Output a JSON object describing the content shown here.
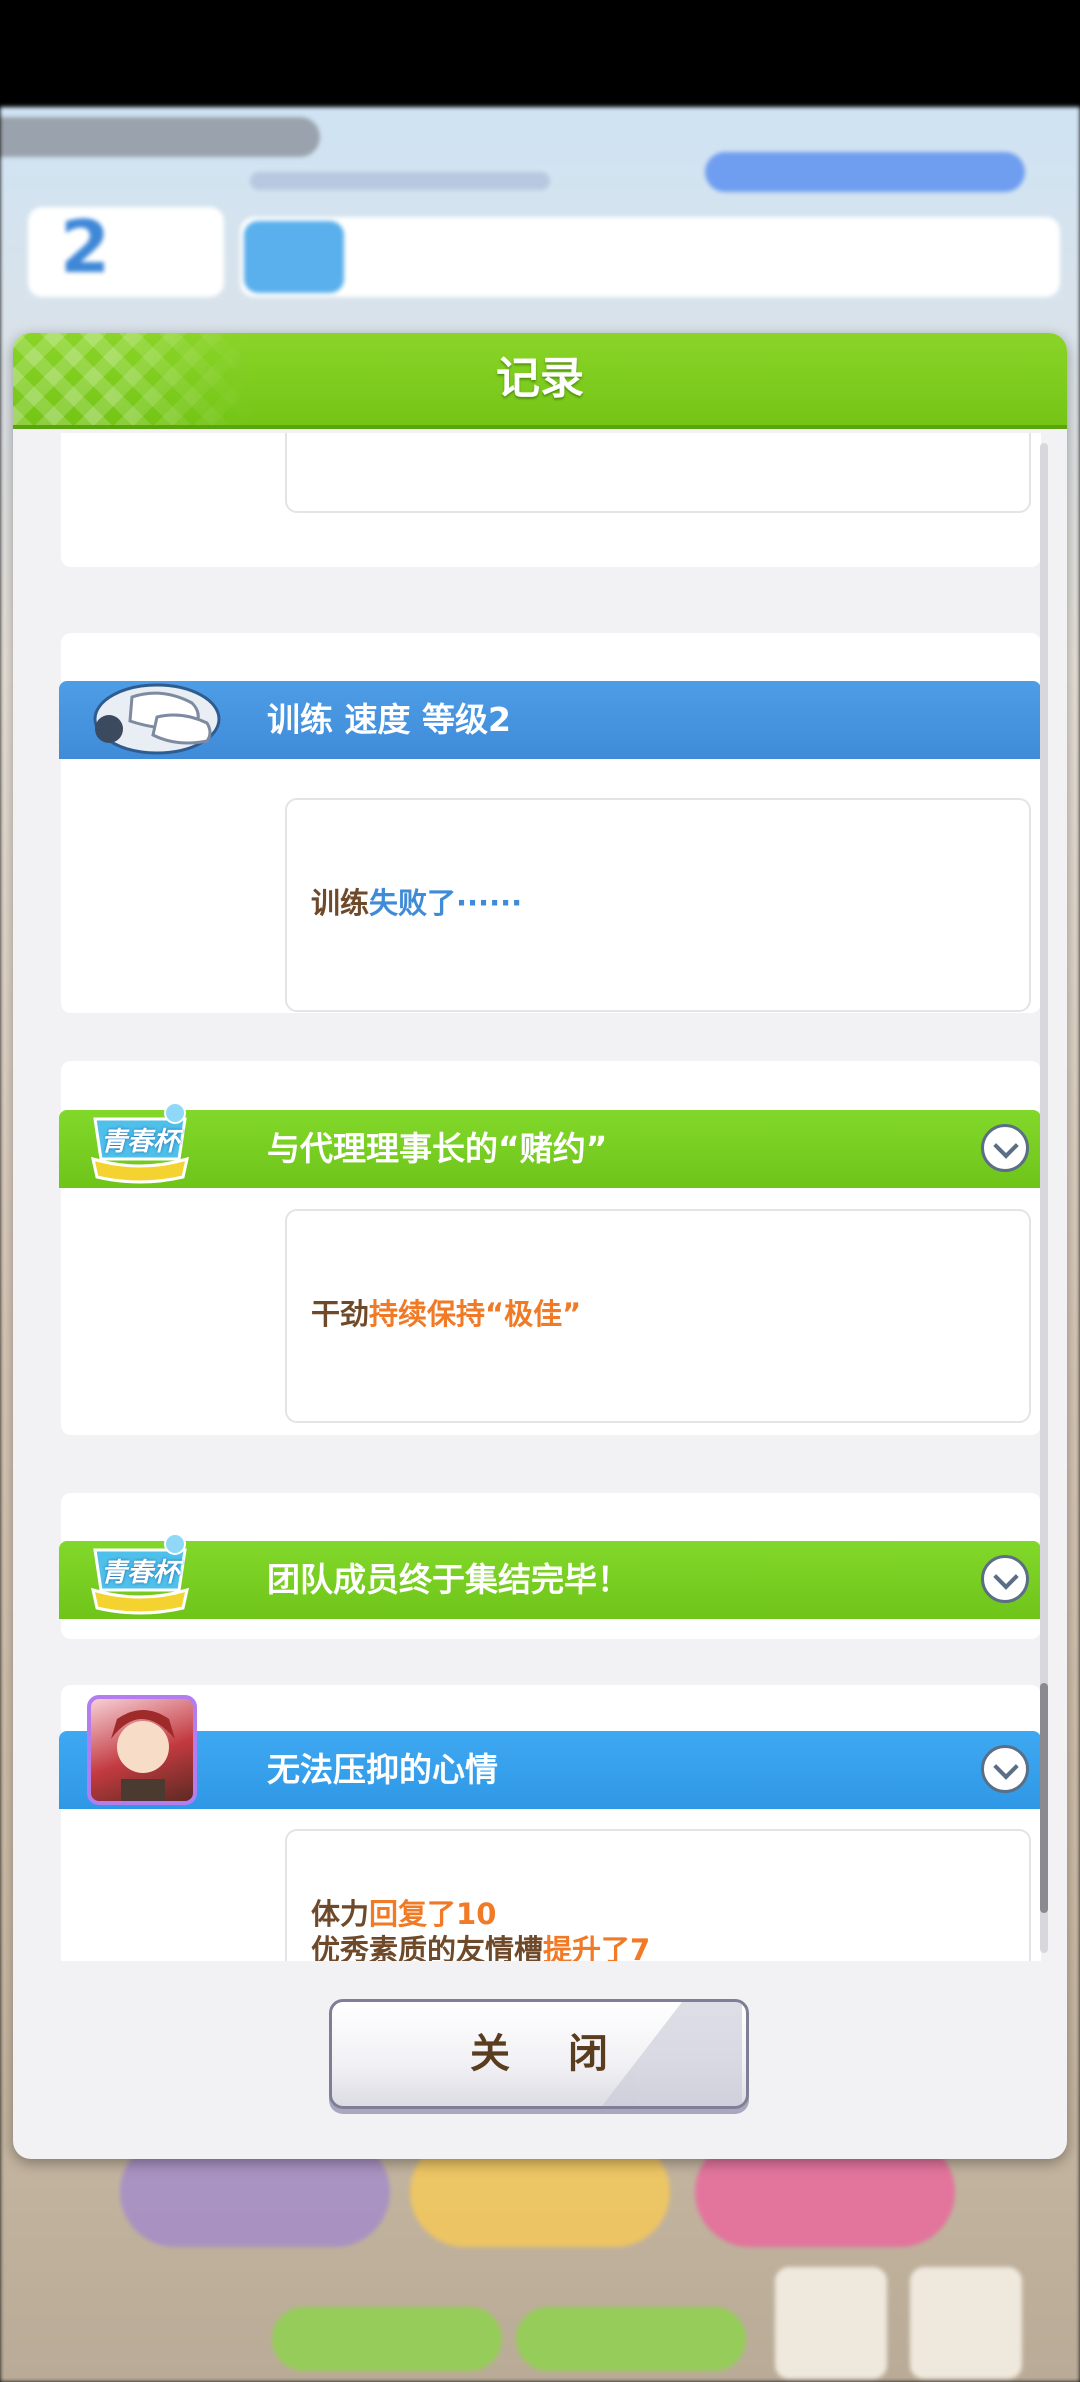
{
  "dialog": {
    "title": "记录",
    "close_label": "关 闭"
  },
  "entries": [
    {
      "title": "训练 速度 等级2",
      "icon": "training-shoes-icon",
      "message_parts": [
        "训练",
        "失败了······"
      ]
    },
    {
      "title": "与代理理事长的“赌约”",
      "icon": "aoharu-cup-event-icon",
      "icon_text": "青春杯",
      "message_parts": [
        "干劲",
        "持续保持“极佳”"
      ]
    },
    {
      "title": "团队成员终于集结完毕！",
      "icon": "aoharu-cup-event-icon",
      "icon_text": "青春杯"
    },
    {
      "title": "无法压抑的心情",
      "icon": "character-portrait-icon",
      "message_lines": [
        [
          "体力",
          "回复了10"
        ],
        [
          "优秀素质的友情槽",
          "提升了7"
        ]
      ]
    }
  ],
  "background": {
    "turn_number": "2",
    "colors": {
      "green_header": "#7ccf1e",
      "blue_header": "#4895e0",
      "skyblue_header": "#38a2ef",
      "brown_text": "#6e4a2a",
      "orange_text": "#f07a26",
      "blue_text": "#3f8bd8"
    }
  }
}
